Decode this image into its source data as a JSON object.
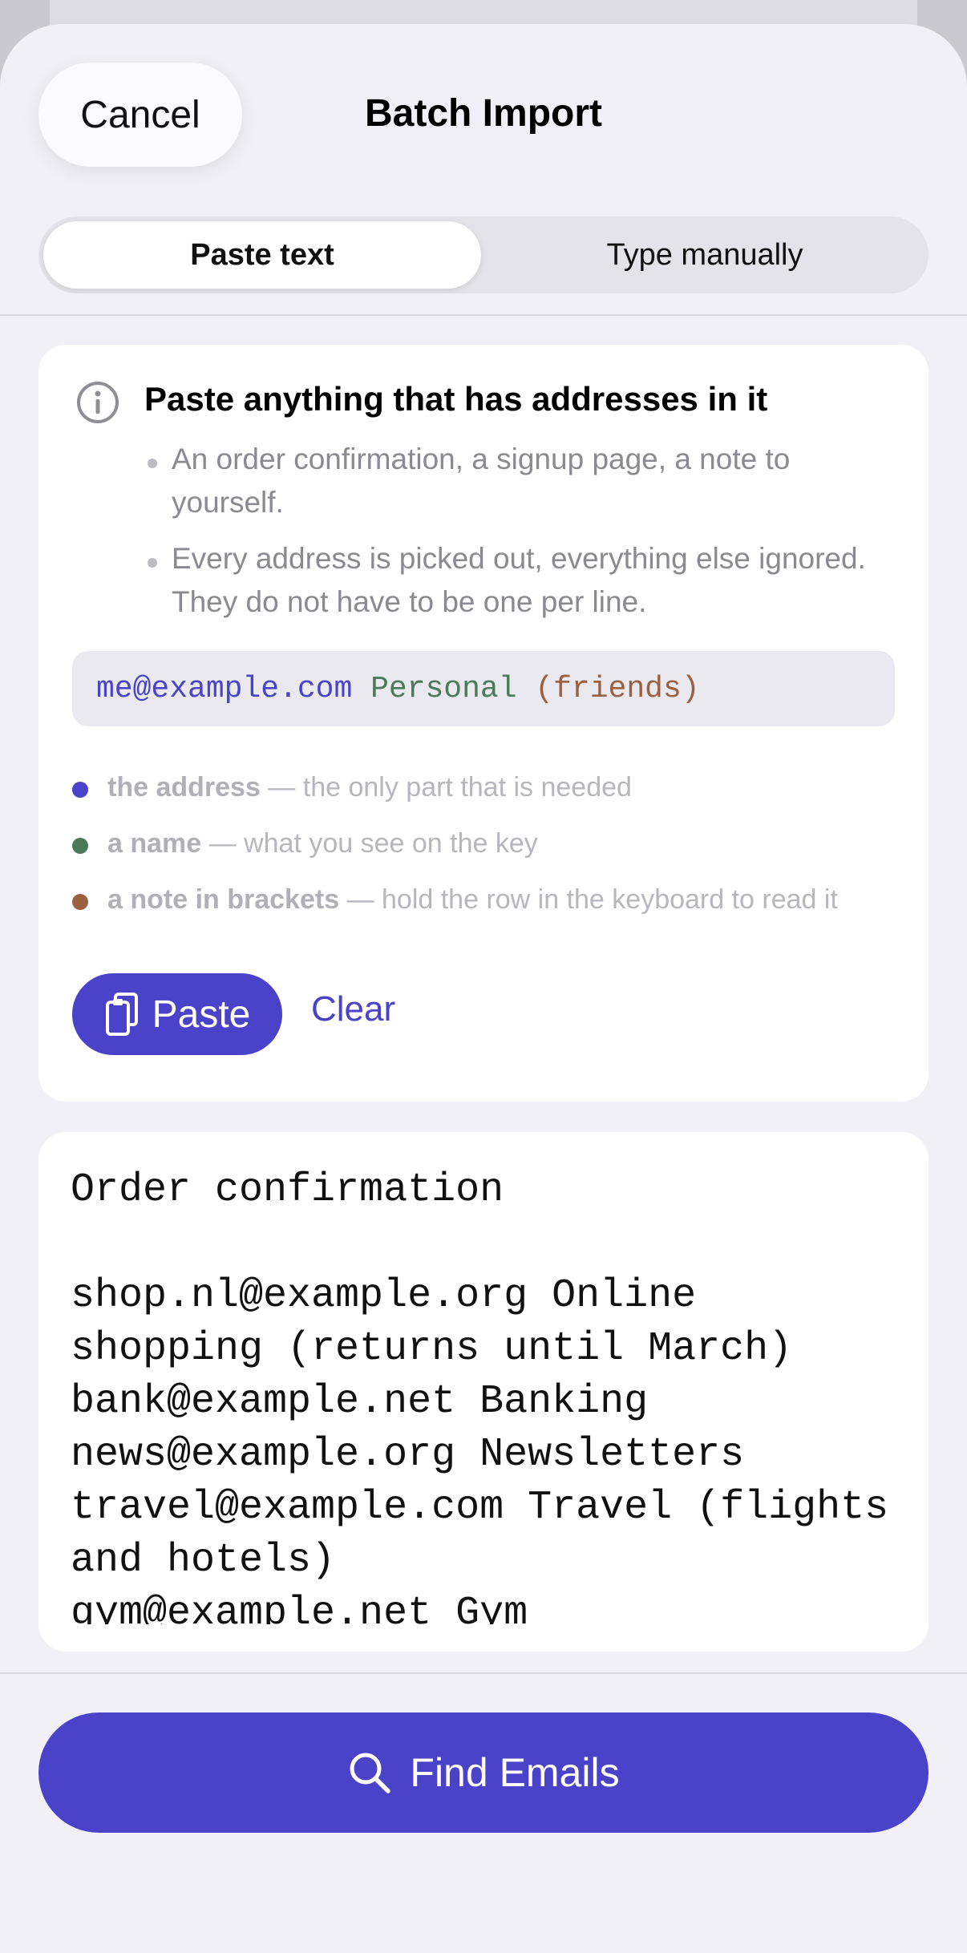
{
  "header": {
    "cancel_label": "Cancel",
    "title": "Batch Import"
  },
  "segmented": {
    "options": [
      "Paste text",
      "Type manually"
    ],
    "selected": "Paste text"
  },
  "info": {
    "icon": "info-circle-icon",
    "title": "Paste anything that has addresses in it",
    "bullets": [
      "An order confirmation, a signup page, a note to yourself.",
      "Every address is picked out, everything else ignored. They do not have to be one per line."
    ],
    "sample": {
      "address": "me@example.com",
      "name": "Personal",
      "note": "(friends)"
    },
    "legend": [
      {
        "term": "the address",
        "desc": " — the only part that is needed",
        "color": "#4a42c8"
      },
      {
        "term": "a name",
        "desc": " — what you see on the key",
        "color": "#4a7a5a"
      },
      {
        "term": "a note in brackets",
        "desc": " — hold the row in the keyboard to read it",
        "color": "#9a6040"
      }
    ],
    "paste_label": "Paste",
    "paste_icon": "clipboard-icon",
    "clear_label": "Clear"
  },
  "colors": {
    "accent": "#4a42c8",
    "address": "#4a42c8",
    "name": "#4a7a5a",
    "note": "#9a6040"
  },
  "input_text": "Order confirmation\n\nshop.nl@example.org Online shopping (returns until March)\nbank@example.net Banking\nnews@example.org Newsletters\ntravel@example.com Travel (flights and hotels)\ngym@example.net Gym",
  "footer": {
    "find_label": "Find Emails",
    "find_icon": "search-icon"
  }
}
